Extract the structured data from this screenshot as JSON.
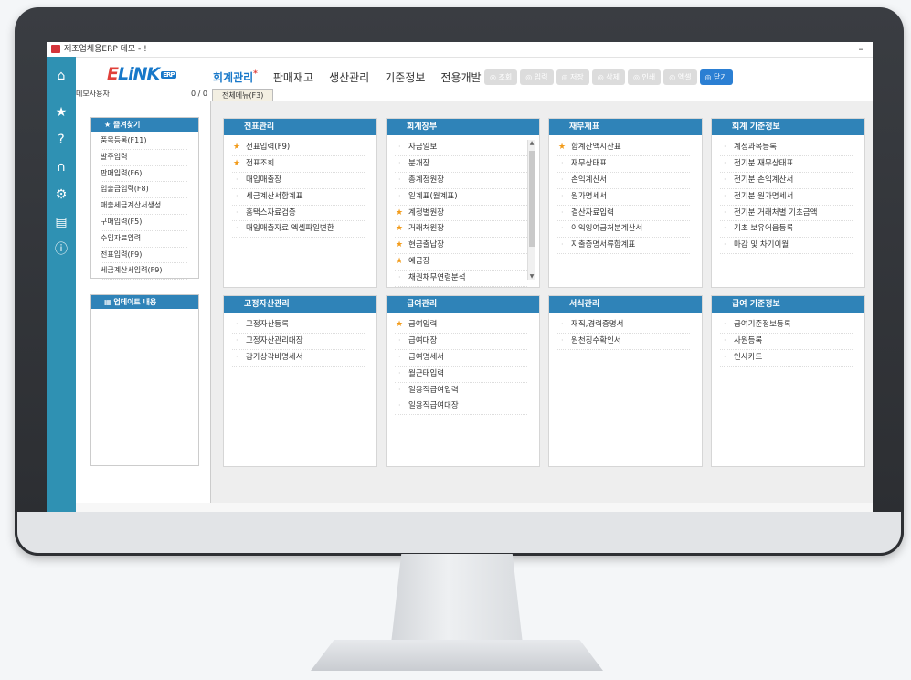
{
  "window": {
    "title": "제조업체용ERP 데모 - !",
    "minimize": "–"
  },
  "brand": {
    "e": "E",
    "name": "LiNK",
    "tag": "ERP"
  },
  "top_menu": [
    "회계관리",
    "판매재고",
    "생산관리",
    "기준정보",
    "전용개발"
  ],
  "toolbar": [
    "조회",
    "입력",
    "저장",
    "삭제",
    "인쇄",
    "엑셀",
    "닫기"
  ],
  "user": {
    "name": "데모사용자",
    "count": "0 / 0"
  },
  "tab": {
    "label": "전체메뉴(F3)"
  },
  "favorites": {
    "title": "즐겨찾기",
    "items": [
      "품목등록(F11)",
      "발주입력",
      "판매입력(F6)",
      "입출금입력(F8)",
      "매출세금계산서생성",
      "구매입력(F5)",
      "수입자료입력",
      "전표입력(F9)",
      "세금계산서입력(F9)"
    ]
  },
  "updates": {
    "title": "업데이트 내용"
  },
  "cards": [
    {
      "title": "전표관리",
      "items": [
        {
          "label": "전표입력(F9)",
          "star": true
        },
        {
          "label": "전표조회",
          "star": true
        },
        {
          "label": "매입매출장",
          "star": false
        },
        {
          "label": "세금계산서합계표",
          "star": false
        },
        {
          "label": "홈택스자료검증",
          "star": false
        },
        {
          "label": "매입매출자료 엑셀파일변환",
          "star": false
        }
      ]
    },
    {
      "title": "회계장부",
      "items": [
        {
          "label": "자금일보",
          "star": false
        },
        {
          "label": "분개장",
          "star": false
        },
        {
          "label": "총계정원장",
          "star": false
        },
        {
          "label": "일계표(월계표)",
          "star": false
        },
        {
          "label": "계정별원장",
          "star": true
        },
        {
          "label": "거래처원장",
          "star": true
        },
        {
          "label": "현금출납장",
          "star": true
        },
        {
          "label": "예금장",
          "star": true
        },
        {
          "label": "채권채무연령분석",
          "star": false
        }
      ]
    },
    {
      "title": "재무제표",
      "items": [
        {
          "label": "합계잔액시산표",
          "star": true
        },
        {
          "label": "재무상태표",
          "star": false
        },
        {
          "label": "손익계산서",
          "star": false
        },
        {
          "label": "원가명세서",
          "star": false
        },
        {
          "label": "결산자료입력",
          "star": false
        },
        {
          "label": "이익잉여금처분계산서",
          "star": false
        },
        {
          "label": "지출증명서류합계표",
          "star": false
        }
      ]
    },
    {
      "title": "회계 기준정보",
      "items": [
        {
          "label": "계정과목등록",
          "star": false
        },
        {
          "label": "전기분 재무상태표",
          "star": false
        },
        {
          "label": "전기분 손익계산서",
          "star": false
        },
        {
          "label": "전기분 원가명세서",
          "star": false
        },
        {
          "label": "전기분 거래처별 기초금액",
          "star": false
        },
        {
          "label": "기초 보유어음등록",
          "star": false
        },
        {
          "label": "마감 및 차기이월",
          "star": false
        }
      ]
    },
    {
      "title": "고정자산관리",
      "items": [
        {
          "label": "고정자산등록",
          "star": false
        },
        {
          "label": "고정자산관리대장",
          "star": false
        },
        {
          "label": "감가상각비명세서",
          "star": false
        }
      ]
    },
    {
      "title": "급여관리",
      "items": [
        {
          "label": "급여입력",
          "star": true
        },
        {
          "label": "급여대장",
          "star": false
        },
        {
          "label": "급여명세서",
          "star": false
        },
        {
          "label": "월근태입력",
          "star": false
        },
        {
          "label": "일용직급여입력",
          "star": false
        },
        {
          "label": "일용직급여대장",
          "star": false
        }
      ]
    },
    {
      "title": "서식관리",
      "items": [
        {
          "label": "재직,경력증명서",
          "star": false
        },
        {
          "label": "원천징수확인서",
          "star": false
        }
      ]
    },
    {
      "title": "급여 기준정보",
      "items": [
        {
          "label": "급여기준정보등록",
          "star": false
        },
        {
          "label": "사원등록",
          "star": false
        },
        {
          "label": "인사카드",
          "star": false
        }
      ]
    }
  ],
  "colors": {
    "rail": "#2f91b3",
    "header": "#2f83b8",
    "accent": "#1878c9",
    "star": "#f29b1a"
  }
}
